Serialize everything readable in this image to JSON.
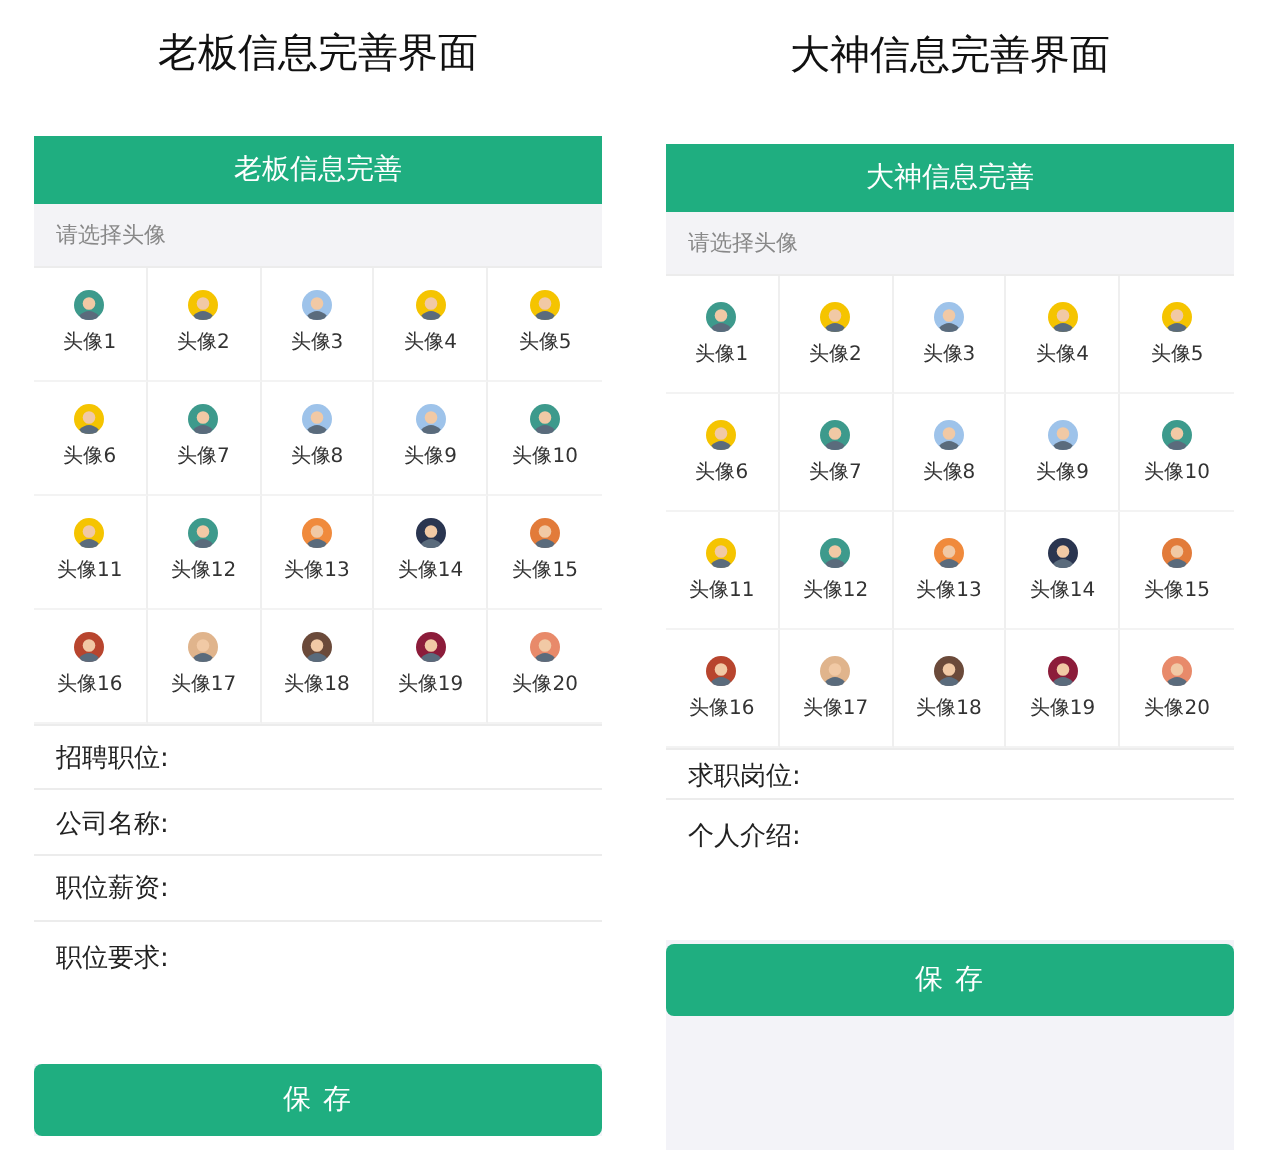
{
  "screens": [
    {
      "caption": "老板信息完善界面",
      "header": "老板信息完善",
      "prompt": "请选择头像",
      "avatars": [
        {
          "label": "头像1",
          "color": "#3d9a8c"
        },
        {
          "label": "头像2",
          "color": "#f5c400"
        },
        {
          "label": "头像3",
          "color": "#9ec3ea"
        },
        {
          "label": "头像4",
          "color": "#f5c400"
        },
        {
          "label": "头像5",
          "color": "#f5c400"
        },
        {
          "label": "头像6",
          "color": "#f5c400"
        },
        {
          "label": "头像7",
          "color": "#3d9a8c"
        },
        {
          "label": "头像8",
          "color": "#9ec3ea"
        },
        {
          "label": "头像9",
          "color": "#9ec3ea"
        },
        {
          "label": "头像10",
          "color": "#3d9a8c"
        },
        {
          "label": "头像11",
          "color": "#f5c400"
        },
        {
          "label": "头像12",
          "color": "#3d9a8c"
        },
        {
          "label": "头像13",
          "color": "#f08a3c"
        },
        {
          "label": "头像14",
          "color": "#2a3550"
        },
        {
          "label": "头像15",
          "color": "#e27b3a"
        },
        {
          "label": "头像16",
          "color": "#b8452e"
        },
        {
          "label": "头像17",
          "color": "#e0b48c"
        },
        {
          "label": "头像18",
          "color": "#6b4a3a"
        },
        {
          "label": "头像19",
          "color": "#8c1c3a"
        },
        {
          "label": "头像20",
          "color": "#e88a6a"
        }
      ],
      "fields": [
        {
          "label": "招聘职位:",
          "kind": "line"
        },
        {
          "label": "公司名称:",
          "kind": "line"
        },
        {
          "label": "职位薪资:",
          "kind": "line"
        },
        {
          "label": "职位要求:",
          "kind": "area"
        }
      ],
      "button": "保 存"
    },
    {
      "caption": "大神信息完善界面",
      "header": "大神信息完善",
      "prompt": "请选择头像",
      "avatars": [
        {
          "label": "头像1",
          "color": "#3d9a8c"
        },
        {
          "label": "头像2",
          "color": "#f5c400"
        },
        {
          "label": "头像3",
          "color": "#9ec3ea"
        },
        {
          "label": "头像4",
          "color": "#f5c400"
        },
        {
          "label": "头像5",
          "color": "#f5c400"
        },
        {
          "label": "头像6",
          "color": "#f5c400"
        },
        {
          "label": "头像7",
          "color": "#3d9a8c"
        },
        {
          "label": "头像8",
          "color": "#9ec3ea"
        },
        {
          "label": "头像9",
          "color": "#9ec3ea"
        },
        {
          "label": "头像10",
          "color": "#3d9a8c"
        },
        {
          "label": "头像11",
          "color": "#f5c400"
        },
        {
          "label": "头像12",
          "color": "#3d9a8c"
        },
        {
          "label": "头像13",
          "color": "#f08a3c"
        },
        {
          "label": "头像14",
          "color": "#2a3550"
        },
        {
          "label": "头像15",
          "color": "#e27b3a"
        },
        {
          "label": "头像16",
          "color": "#b8452e"
        },
        {
          "label": "头像17",
          "color": "#e0b48c"
        },
        {
          "label": "头像18",
          "color": "#6b4a3a"
        },
        {
          "label": "头像19",
          "color": "#8c1c3a"
        },
        {
          "label": "头像20",
          "color": "#e88a6a"
        }
      ],
      "fields": [
        {
          "label": "求职岗位:",
          "kind": "line"
        },
        {
          "label": "个人介绍:",
          "kind": "area"
        }
      ],
      "button": "保 存"
    }
  ]
}
